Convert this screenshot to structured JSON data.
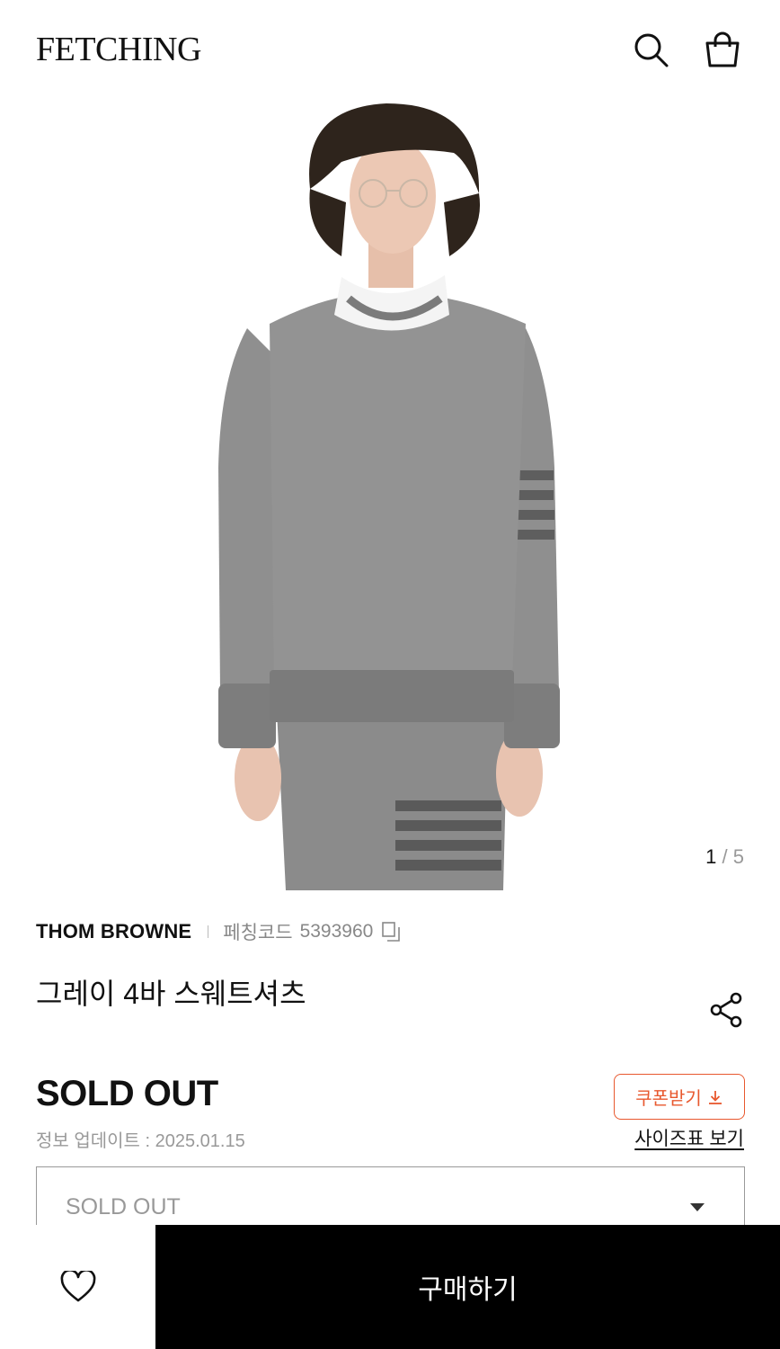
{
  "header": {
    "logo": "FETCHING",
    "icons": {
      "search": "search-icon",
      "bag": "shopping-bag-icon"
    }
  },
  "gallery": {
    "image": "product-photo",
    "counter_current": "1",
    "counter_sep": " / ",
    "counter_total": "5"
  },
  "product": {
    "brand": "THOM BROWNE",
    "code_label": "페칭코드",
    "code_value": "5393960",
    "title": "그레이 4바 스웨트셔츠",
    "price": "SOLD OUT",
    "updated": "정보 업데이트 : 2025.01.15",
    "coupon_label": "쿠폰받기",
    "size_chart_label": "사이즈표 보기"
  },
  "option_select": {
    "value": "SOLD OUT"
  },
  "bottom": {
    "buy_label": "구매하기",
    "wish_icon": "heart-icon"
  },
  "colors": {
    "accent": "#e8582e",
    "sweater_gray": "#8e8e8e",
    "stripe_gray": "#5e5e5e"
  }
}
